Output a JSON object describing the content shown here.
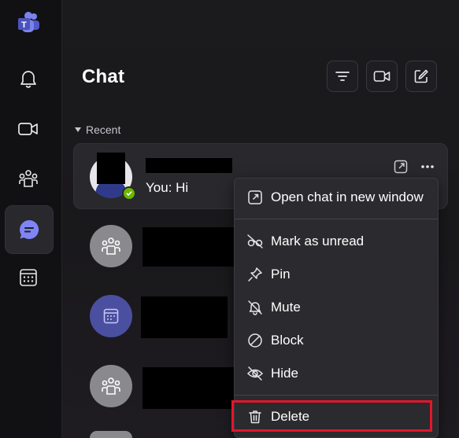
{
  "app": {
    "name": "Microsoft Teams"
  },
  "rail": {
    "items": [
      {
        "id": "activity",
        "icon": "bell-icon"
      },
      {
        "id": "meet",
        "icon": "video-camera-icon"
      },
      {
        "id": "communities",
        "icon": "people-community-icon"
      },
      {
        "id": "chat",
        "icon": "chat-bubble-icon",
        "active": true
      },
      {
        "id": "calendar",
        "icon": "calendar-icon"
      }
    ]
  },
  "header": {
    "title": "Chat",
    "buttons": [
      {
        "id": "filter",
        "icon": "filter-icon"
      },
      {
        "id": "meet-now",
        "icon": "video-camera-icon"
      },
      {
        "id": "new-chat",
        "icon": "compose-icon"
      }
    ]
  },
  "section": {
    "label": "Recent"
  },
  "chats": [
    {
      "avatar": "user-photo",
      "preview": "You: Hi",
      "presence": "available",
      "selected": true
    },
    {
      "avatar": "group-icon"
    },
    {
      "avatar": "calendar-icon"
    },
    {
      "avatar": "group-icon"
    }
  ],
  "context_menu": {
    "items": [
      {
        "label": "Open chat in new window",
        "icon": "pop-out-icon"
      },
      {
        "label": "Mark as unread",
        "icon": "eye-off-icon"
      },
      {
        "label": "Pin",
        "icon": "pin-icon"
      },
      {
        "label": "Mute",
        "icon": "bell-off-icon"
      },
      {
        "label": "Block",
        "icon": "block-icon"
      },
      {
        "label": "Hide",
        "icon": "hide-icon"
      },
      {
        "label": "Delete",
        "icon": "trash-icon",
        "highlighted": true
      }
    ]
  },
  "colors": {
    "accent": "#7f85f5",
    "presence_available": "#6bb700",
    "highlight_box": "#e3162b"
  }
}
